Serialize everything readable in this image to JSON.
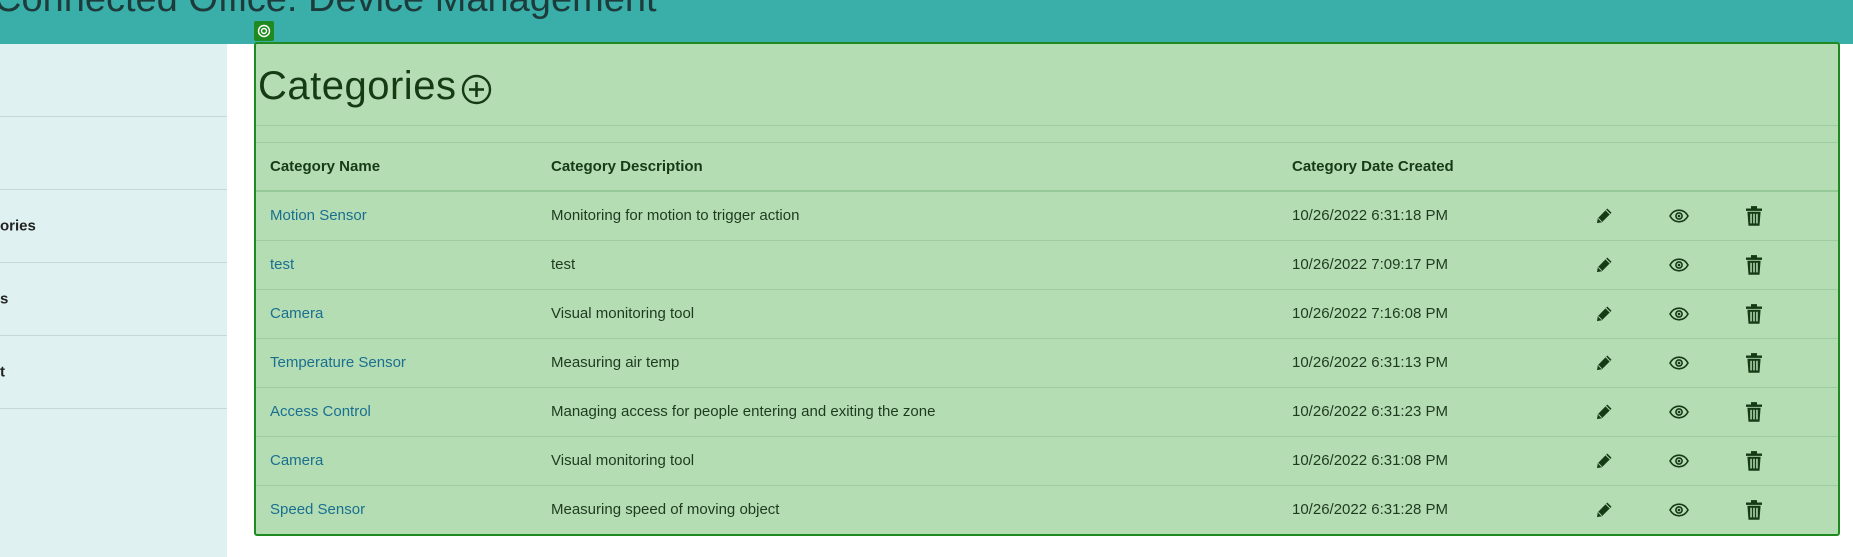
{
  "app": {
    "title": "Connected Office: Device Management"
  },
  "sidebar": {
    "items": [
      {
        "label": ""
      },
      {
        "label": ""
      },
      {
        "label": "ories"
      },
      {
        "label": "s"
      },
      {
        "label": "t"
      }
    ]
  },
  "page": {
    "title": "Categories",
    "add_icon": "circle-plus-icon"
  },
  "table": {
    "headers": [
      "Category Name",
      "Category Description",
      "Category Date Created"
    ],
    "rows": [
      {
        "name": "Motion Sensor",
        "description": "Monitoring for motion to trigger action",
        "created": "10/26/2022 6:31:18 PM"
      },
      {
        "name": "test",
        "description": "test",
        "created": "10/26/2022 7:09:17 PM"
      },
      {
        "name": "Camera",
        "description": "Visual monitoring tool",
        "created": "10/26/2022 7:16:08 PM"
      },
      {
        "name": "Temperature Sensor",
        "description": "Measuring air temp",
        "created": "10/26/2022 6:31:13 PM"
      },
      {
        "name": "Access Control",
        "description": "Managing access for people entering and exiting the zone",
        "created": "10/26/2022 6:31:23 PM"
      },
      {
        "name": "Camera",
        "description": "Visual monitoring tool",
        "created": "10/26/2022 6:31:08 PM"
      },
      {
        "name": "Speed Sensor",
        "description": "Measuring speed of moving object",
        "created": "10/26/2022 6:31:28 PM"
      }
    ],
    "action_icons": [
      "pencil-icon",
      "eye-icon",
      "trash-icon"
    ]
  },
  "colors": {
    "topbar": "#3aafaa",
    "sidebar": "#dff2f1",
    "panel": "#b4ddb4",
    "panel_border": "#1f8a1f",
    "link": "#1a6f8f",
    "heading": "#163a16"
  }
}
